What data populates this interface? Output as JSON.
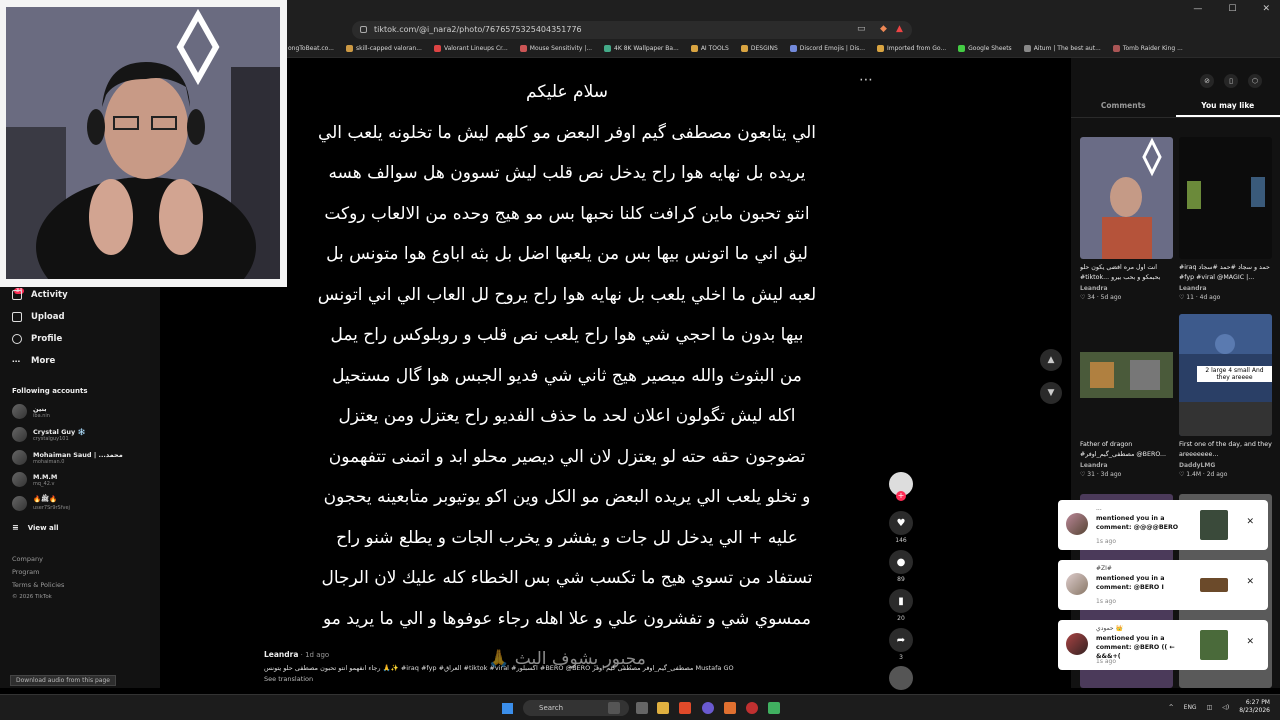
{
  "browser": {
    "url": "tiktok.com/@i_nara2/photo/7676575325404351776",
    "bookmarks": [
      "ongToBeat.co...",
      "skill-capped valoran...",
      "Valorant Lineups Cr...",
      "Mouse Sensitivity |...",
      "4K 8K Wallpaper Ba...",
      "AI TOOLS",
      "DESGINS",
      "Discord Emojis | Dis...",
      "Imported from Go...",
      "Google Sheets",
      "Aitum | The best aut...",
      "Tomb Raider King ..."
    ],
    "window_controls": [
      "—",
      "☐",
      "✕"
    ]
  },
  "sidebar": {
    "badge": "34",
    "nav": [
      {
        "label": "Activity",
        "icon": "bell-icon"
      },
      {
        "label": "Upload",
        "icon": "plus-icon"
      },
      {
        "label": "Profile",
        "icon": "person-icon"
      },
      {
        "label": "More",
        "icon": "dots-icon"
      }
    ],
    "following_title": "Following accounts",
    "accounts": [
      {
        "name": "بنين",
        "handle": "iba.nin"
      },
      {
        "name": "Crystal Guy ❄️",
        "handle": "crystalguy101"
      },
      {
        "name": "Mohaiman Saud | ...محمد",
        "handle": "mohaiman.0"
      },
      {
        "name": "M.M.M",
        "handle": "mq_42.v"
      },
      {
        "name": "🔥ﷺ🔥",
        "handle": "user7Sr9rSfvej"
      }
    ],
    "view_all": "View all",
    "footer": [
      "Company",
      "Program",
      "Terms & Policies",
      "© 2026 TikTok"
    ]
  },
  "post": {
    "lines": [
      "سلام عليكم",
      "الي يتابعون مصطفى گيم اوفر البعض مو كلهم ليش ما تخلونه يلعب الي",
      "يريده بل نهايه هوا راح يدخل نص قلب ليش تسوون هل سوالف هسه",
      "انتو تحبون ماين كرافت كلنا نحبها بس مو هيج وحده من الالعاب روكت",
      "ليق اني ما اتونس بيها بس من يلعبها اضل بل بثه اباوع هوا متونس بل",
      "لعبه ليش ما اخلي يلعب بل نهايه هوا راح يروح لل العاب الي اني اتونس",
      "بيها بدون ما احجي شي هوا راح يلعب نص قلب و روبلوكس  راح يمل",
      "من البثوث  والله ميصير هيج ثاني شي فديو الجبس هوا گال مستحيل",
      "اكله ليش تگولون اعلان لحد ما حذف الفديو راح يعتزل ومن يعتزل",
      "تضوجون حقه حته لو يعتزل لان الي ديصير  محلو ابد و اتمنى تتفهمون",
      "و تخلو يلعب الي يريده البعض مو الكل وين اكو يوتيوبر متابعينه يحجون",
      "عليه + الي يدخل لل جات و يفشر و يخرب الجات و يطلع شنو راح",
      "تستفاد من تسوي هيج ما تكسب شي بس الخطاء كله عليك لان الرجال",
      "ممسوي شي و تفشرون علي و علا اهله رجاء عوفوها و الي ما يريد مو",
      "مجبور يشوف البث 🙏"
    ],
    "author": "Leandra",
    "time": " · 1d ago",
    "description": "رجاء انفهمو انتو تحبون مصطفى حلو يتونس 🙏✨ #iraq #fyp #العراق #tiktok #viral #اكسبلور #BERO @BERO مصطفى_گيم_اوفر مصطفى گيم اوفر Mustafa GO",
    "see_translation": "See translation"
  },
  "actions": {
    "likes": "146",
    "comments": "89",
    "saves": "20",
    "shares": "3"
  },
  "panel": {
    "tabs": [
      "Comments",
      "You may like"
    ],
    "active_tab": "You may like",
    "cards": [
      {
        "title": "انت اول مره افضى يكون حلو #tiktok... بحبمكو و بحب بيرو",
        "author": "Leandra",
        "stats": "♡ 34 · 5d ago"
      },
      {
        "title": "#iraq حمد و سجاد #حمد #سجاد #fyp #viral @MAGIC |...",
        "author": "Leandra",
        "stats": "♡ 11 · 4d ago"
      },
      {
        "title": "Father of dragon #مصطفى_گيم_اوفر @BERO...",
        "author": "Leandra",
        "stats": "♡ 31 · 3d ago"
      },
      {
        "title": "First one of the day, and they areeeeeee...",
        "author": "DaddyLMG",
        "stats": "♡ 1.4M · 2d ago"
      }
    ],
    "card4_overlay": "2 large 4 small And they areeee"
  },
  "notifications": [
    {
      "name": "...",
      "msg": "mentioned you in a comment: @@@@BERO",
      "time": "1s ago"
    },
    {
      "name": "#ZI#",
      "msg": "mentioned you in a comment: @BERO I",
      "time": "1s ago"
    },
    {
      "name": "حمودي 👑",
      "msg": "mentioned you in a comment: @BERO (( ← &&&+(",
      "time": "1s ago"
    }
  ],
  "download_audio": "Download audio from this page",
  "taskbar": {
    "search": "Search",
    "lang": "ENG",
    "time": "6:27 PM",
    "date": "8/23/2026"
  },
  "colors": {
    "accent": "#fe2c55",
    "bg": "#000000",
    "panel": "#121212"
  }
}
